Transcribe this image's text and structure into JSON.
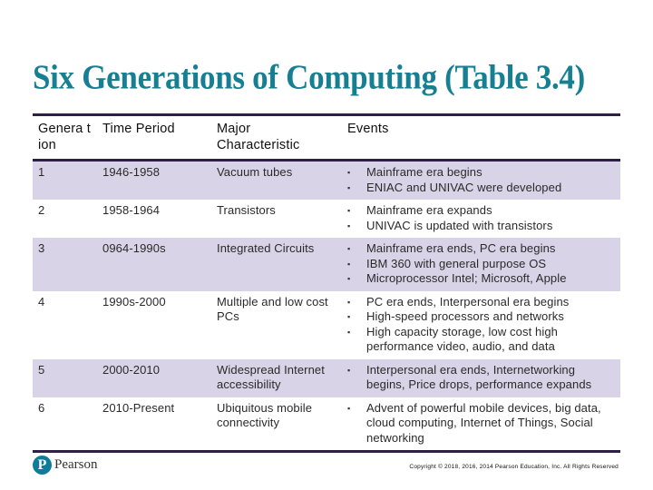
{
  "slide": {
    "title": "Six Generations of Computing (Table 3.4)"
  },
  "table": {
    "headers": [
      "Genera tion",
      "Time Period",
      "Major Characteristic",
      "Events"
    ],
    "rows": [
      {
        "generation": "1",
        "time_period": "1946-1958",
        "characteristic": "Vacuum tubes",
        "events": [
          "Mainframe era begins",
          "ENIAC and UNIVAC were developed"
        ]
      },
      {
        "generation": "2",
        "time_period": "1958-1964",
        "characteristic": "Transistors",
        "events": [
          "Mainframe era expands",
          "UNIVAC is updated with transistors"
        ]
      },
      {
        "generation": "3",
        "time_period": "0964-1990s",
        "characteristic": "Integrated Circuits",
        "events": [
          "Mainframe era ends, PC era begins",
          "IBM 360 with general purpose OS",
          "Microprocessor Intel; Microsoft, Apple"
        ]
      },
      {
        "generation": "4",
        "time_period": "1990s-2000",
        "characteristic": "Multiple and low cost PCs",
        "events": [
          "PC era ends, Interpersonal era begins",
          "High-speed processors and networks",
          "High capacity storage, low cost high performance video, audio, and data"
        ]
      },
      {
        "generation": "5",
        "time_period": "2000-2010",
        "characteristic": "Widespread Internet accessibility",
        "events": [
          "Interpersonal era ends, Internetworking begins, Price drops, performance expands"
        ]
      },
      {
        "generation": "6",
        "time_period": "2010-Present",
        "characteristic": "Ubiquitous mobile connectivity",
        "events": [
          "Advent of powerful mobile devices, big data, cloud computing, Internet of Things, Social networking"
        ]
      }
    ]
  },
  "footer": {
    "logo_icon": "pearson-p-icon",
    "logo_glyph": "P",
    "logo_text": "Pearson",
    "copyright": "Copyright © 2018, 2016, 2014 Pearson Education, Inc. All Rights Reserved"
  },
  "colors": {
    "title": "#167f92",
    "rule": "#2e1f47",
    "shaded_row": "#d8d3e6",
    "logo": "#0f7c99"
  }
}
